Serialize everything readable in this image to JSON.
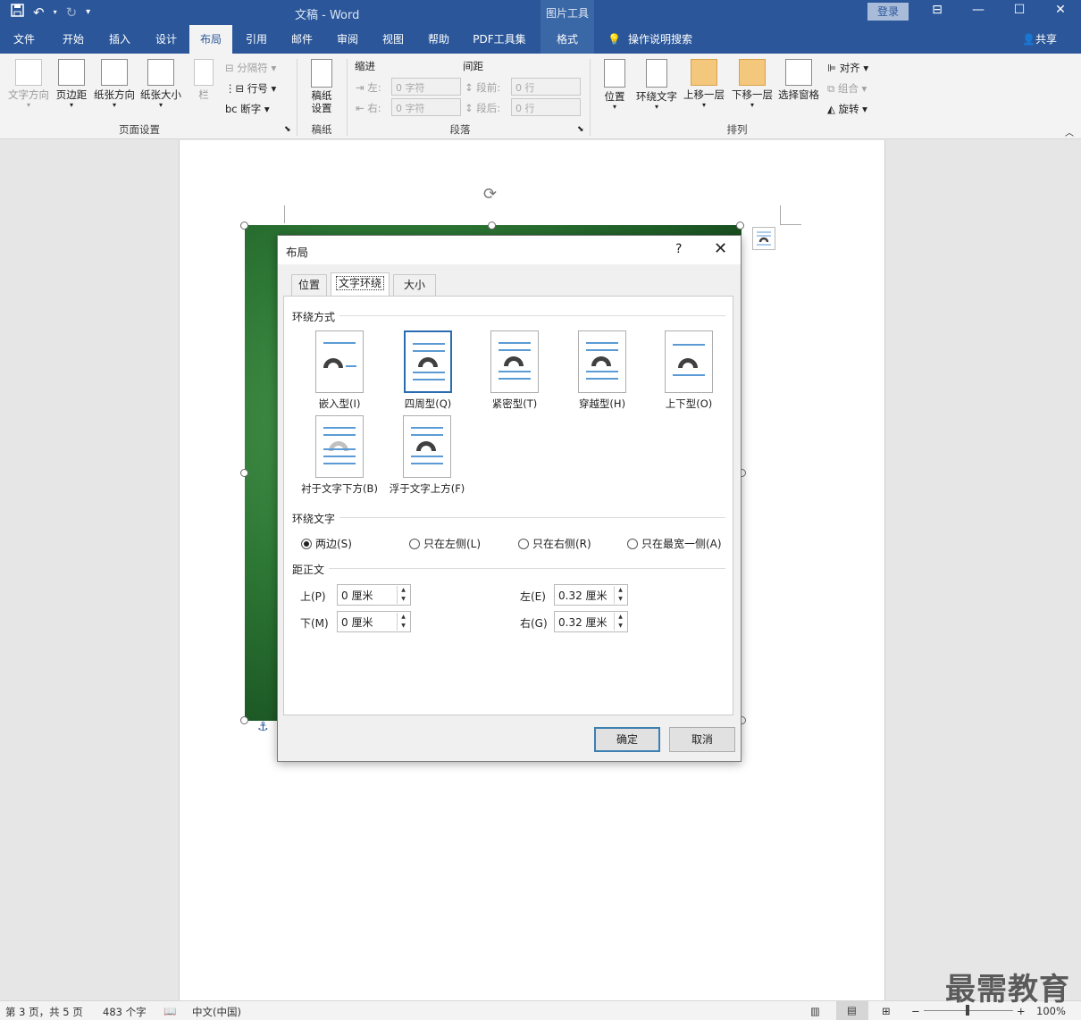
{
  "titlebar": {
    "doc_title": "文稿  -  Word",
    "context_tools": "图片工具",
    "login": "登录",
    "save_icon": "save-icon",
    "undo_icon": "undo-icon",
    "redo_icon": "redo-icon",
    "qat_more": "▾"
  },
  "tabs": {
    "file": "文件",
    "home": "开始",
    "insert": "插入",
    "design": "设计",
    "layout": "布局",
    "references": "引用",
    "mailings": "邮件",
    "review": "审阅",
    "view": "视图",
    "help": "帮助",
    "pdf": "PDF工具集",
    "format": "格式",
    "search": "操作说明搜索",
    "share": "共享"
  },
  "ribbon": {
    "text_direction": "文字方向",
    "margins": "页边距",
    "orientation": "纸张方向",
    "size": "纸张大小",
    "columns": "栏",
    "breaks": "分隔符",
    "line_numbers": "行号",
    "hyphenation": "断字",
    "page_setup": "页面设置",
    "draft_paper_settings": "稿纸\n设置",
    "draft_paper": "稿纸",
    "indent": "缩进",
    "spacing": "间距",
    "indent_left_label": "左:",
    "indent_left_value": "0 字符",
    "indent_right_label": "右:",
    "indent_right_value": "0 字符",
    "space_before_label": "段前:",
    "space_before_value": "0 行",
    "space_after_label": "段后:",
    "space_after_value": "0 行",
    "paragraph": "段落",
    "position": "位置",
    "wrap_text": "环绕文字",
    "bring_forward": "上移一层",
    "send_backward": "下移一层",
    "selection_pane": "选择窗格",
    "align": "对齐",
    "group": "组合",
    "rotate": "旋转",
    "arrange": "排列"
  },
  "dialog": {
    "title": "布局",
    "help": "?",
    "close": "✕",
    "tabs": [
      "位置",
      "文字环绕",
      "大小"
    ],
    "wrap_style_section": "环绕方式",
    "wrap_styles": [
      "嵌入型(I)",
      "四周型(Q)",
      "紧密型(T)",
      "穿越型(H)",
      "上下型(O)",
      "衬于文字下方(B)",
      "浮于文字上方(F)"
    ],
    "wrap_text_section": "环绕文字",
    "wrap_text_options": [
      "两边(S)",
      "只在左侧(L)",
      "只在右侧(R)",
      "只在最宽一侧(A)"
    ],
    "distance_section": "距正文",
    "top_label": "上(P)",
    "top_value": "0 厘米",
    "bottom_label": "下(M)",
    "bottom_value": "0 厘米",
    "left_label": "左(E)",
    "left_value": "0.32 厘米",
    "right_label": "右(G)",
    "right_value": "0.32 厘米",
    "ok": "确定",
    "cancel": "取消"
  },
  "statusbar": {
    "page": "第 3 页，共 5 页",
    "words": "483 个字",
    "language": "中文(中国)",
    "zoom": "100%",
    "zoom_minus": "−",
    "zoom_plus": "+"
  },
  "watermark": "最需教育",
  "colors": {
    "brand": "#2b579a",
    "accent": "#3c7fb1"
  }
}
